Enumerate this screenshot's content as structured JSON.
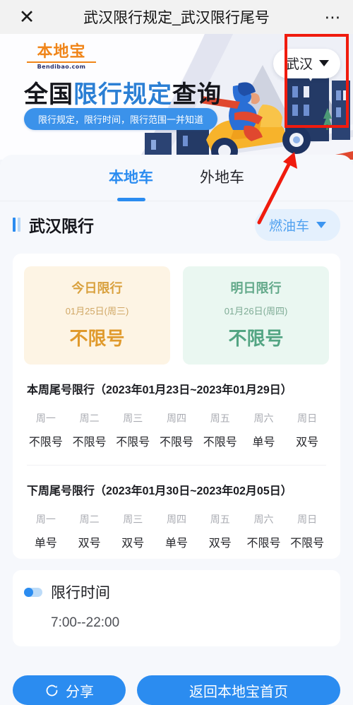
{
  "browser": {
    "close_icon": "close-icon",
    "title": "武汉限行规定_武汉限行尾号",
    "more_icon": "ellipsis-icon"
  },
  "banner": {
    "logo_main": "本地宝",
    "logo_sub": "Bendibao.com",
    "headline_prefix": "全国",
    "headline_highlight": "限行规定",
    "headline_suffix": "查询",
    "subtitle_pill": "限行规定，限行时间，限行范围一并知道",
    "city_selector": {
      "value": "武汉",
      "chevron_icon": "chevron-down-icon"
    },
    "colors": {
      "brand_orange": "#f08519",
      "accent_blue": "#2b7fd4",
      "pill_blue": "#3b92ea",
      "building_navy": "#243a66",
      "scooter_yellow": "#f7b32b",
      "rider_blue": "#2a6fd6"
    }
  },
  "tabs": [
    {
      "label": "本地车",
      "active": true
    },
    {
      "label": "外地车",
      "active": false
    }
  ],
  "section": {
    "title": "武汉限行",
    "marker_icon": "double-bar-icon",
    "fuel_selector": {
      "value": "燃油车",
      "chevron_icon": "chevron-down-icon"
    }
  },
  "day_cards": [
    {
      "label": "今日限行",
      "date": "01月25日(周三)",
      "value": "不限号",
      "theme": "#e09a2c"
    },
    {
      "label": "明日限行",
      "date": "01月26日(周四)",
      "value": "不限号",
      "theme": "#53a583"
    }
  ],
  "weeks": [
    {
      "title": "本周尾号限行（2023年01月23日~2023年01月29日）",
      "days": [
        "周一",
        "周二",
        "周三",
        "周四",
        "周五",
        "周六",
        "周日"
      ],
      "values": [
        "不限号",
        "不限号",
        "不限号",
        "不限号",
        "不限号",
        "单号",
        "双号"
      ]
    },
    {
      "title": "下周尾号限行（2023年01月30日~2023年02月05日）",
      "days": [
        "周一",
        "周二",
        "周三",
        "周四",
        "周五",
        "周六",
        "周日"
      ],
      "values": [
        "单号",
        "双号",
        "双号",
        "单号",
        "双号",
        "不限号",
        "不限号"
      ]
    }
  ],
  "time_section": {
    "marker_icon": "dot-toggle-icon",
    "label": "限行时间",
    "value": "7:00--22:00"
  },
  "buttons": {
    "share_label": "分享",
    "share_icon": "refresh-circle-icon",
    "home_label": "返回本地宝首页",
    "color": "#2b8cf0"
  },
  "annotation": {
    "highlight_color": "#f01b0e",
    "target": "city-selector",
    "shapes": [
      "rectangle",
      "arrow"
    ]
  }
}
